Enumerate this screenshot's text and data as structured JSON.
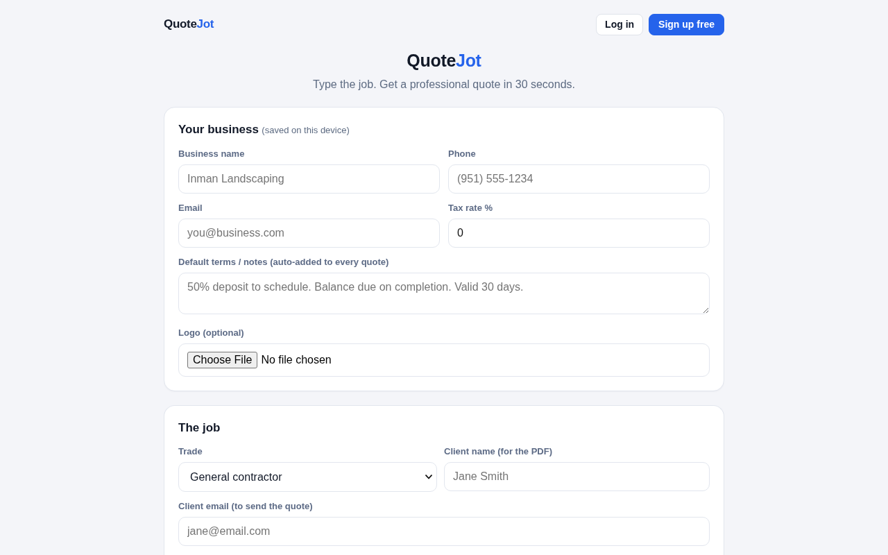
{
  "header": {
    "logo": {
      "main": "Quote",
      "accent": "Jot"
    },
    "buttons": [
      {
        "label": "Log in",
        "kind": "outline"
      },
      {
        "label": "Sign up free",
        "kind": "primary"
      }
    ]
  },
  "hero": {
    "title": {
      "main": "Quote",
      "accent": "Jot"
    },
    "subtitle": "Type the job. Get a professional quote in 30 seconds."
  },
  "sections": [
    {
      "title": "Your business",
      "note": "(saved on this device)",
      "rows": [
        [
          {
            "kind": "text",
            "label": "Business name",
            "placeholder": "Inman Landscaping"
          },
          {
            "kind": "text",
            "label": "Phone",
            "placeholder": "(951) 555-1234"
          }
        ],
        [
          {
            "kind": "text",
            "label": "Email",
            "placeholder": "you@business.com"
          },
          {
            "kind": "text",
            "label": "Tax rate %",
            "value": "0"
          }
        ],
        [
          {
            "kind": "textarea",
            "label": "Default terms / notes (auto-added to every quote)",
            "placeholder": "50% deposit to schedule. Balance due on completion. Valid 30 days."
          }
        ],
        [
          {
            "kind": "file",
            "label": "Logo (optional)",
            "button": "Choose File",
            "status": "No file chosen"
          }
        ]
      ]
    },
    {
      "title": "The job",
      "rows": [
        [
          {
            "kind": "select",
            "label": "Trade",
            "value": "General contractor"
          },
          {
            "kind": "text",
            "label": "Client name (for the PDF)",
            "placeholder": "Jane Smith"
          }
        ],
        [
          {
            "kind": "text",
            "label": "Client email (to send the quote)",
            "placeholder": "jane@email.com"
          }
        ]
      ]
    }
  ]
}
